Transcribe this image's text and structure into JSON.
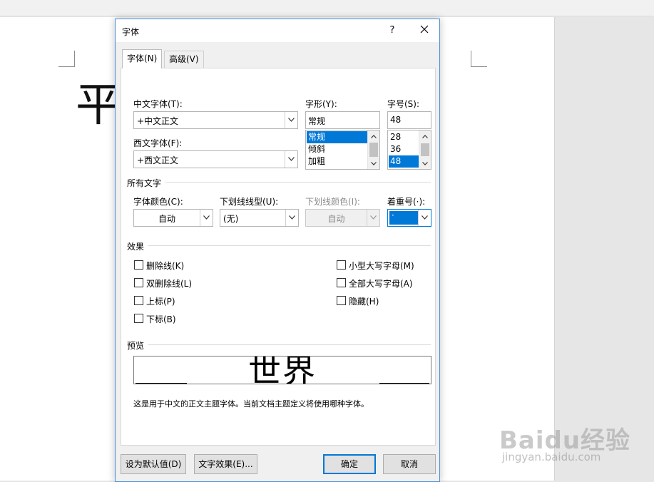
{
  "document": {
    "bg_char": "平"
  },
  "dialog": {
    "title": "字体",
    "help_label": "?",
    "tabs": [
      {
        "label": "字体(N)",
        "active": true
      },
      {
        "label": "高级(V)",
        "active": false
      }
    ],
    "chinese_font": {
      "label": "中文字体(T):",
      "value": "+中文正文"
    },
    "western_font": {
      "label": "西文字体(F):",
      "value": "+西文正文"
    },
    "font_style": {
      "label": "字形(Y):",
      "value": "常规",
      "options": [
        "常规",
        "倾斜",
        "加粗"
      ],
      "selected": "常规"
    },
    "font_size": {
      "label": "字号(S):",
      "value": "48",
      "options": [
        "28",
        "36",
        "48"
      ],
      "selected": "48"
    },
    "all_text": {
      "section_label": "所有文字",
      "font_color": {
        "label": "字体颜色(C):",
        "value": "自动"
      },
      "underline_style": {
        "label": "下划线线型(U):",
        "value": "(无)"
      },
      "underline_color": {
        "label": "下划线颜色(I):",
        "value": "自动"
      },
      "emphasis_mark": {
        "label": "着重号(·):",
        "value": "·"
      }
    },
    "effects": {
      "section_label": "效果",
      "left": [
        "删除线(K)",
        "双删除线(L)",
        "上标(P)",
        "下标(B)"
      ],
      "right": [
        "小型大写字母(M)",
        "全部大写字母(A)",
        "隐藏(H)"
      ]
    },
    "preview": {
      "section_label": "预览",
      "sample": "世界",
      "description": "这是用于中文的正文主题字体。当前文档主题定义将使用哪种字体。"
    },
    "buttons": {
      "set_default": "设为默认值(D)",
      "text_effects": "文字效果(E)...",
      "ok": "确定",
      "cancel": "取消"
    }
  },
  "watermark": {
    "brand": "Baidu经验",
    "url": "jingyan.baidu.com"
  },
  "colors": {
    "accent": "#0078d7",
    "dialog_border": "#4a90d9"
  }
}
